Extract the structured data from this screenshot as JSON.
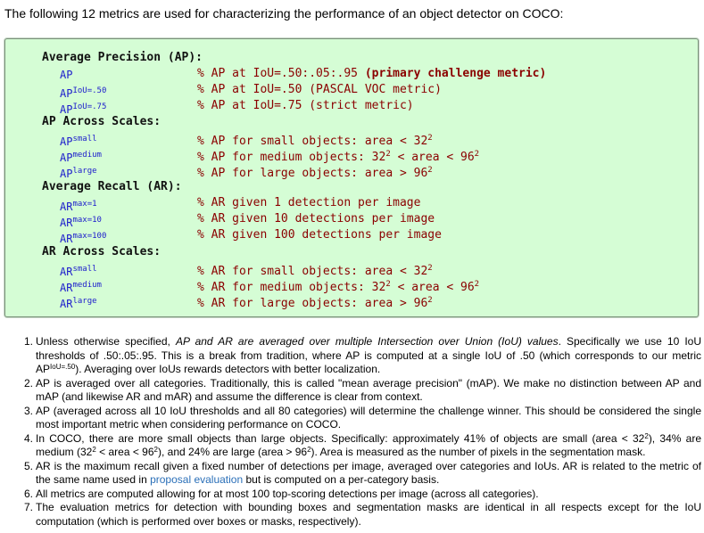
{
  "intro": "The following 12 metrics are used for characterizing the performance of an object detector on COCO:",
  "metrics_box": {
    "rows": [
      {
        "kind": "head",
        "text": "Average Precision (AP):"
      },
      {
        "kind": "item",
        "name": "AP",
        "sup": "",
        "desc": "% AP at IoU=.50:.05:.95",
        "bold": " (primary challenge metric)"
      },
      {
        "kind": "item",
        "name": "AP",
        "sup": "IoU=.50",
        "desc": "% AP at IoU=.50 (PASCAL VOC metric)"
      },
      {
        "kind": "item",
        "name": "AP",
        "sup": "IoU=.75",
        "desc": "% AP at IoU=.75 (strict metric)"
      },
      {
        "kind": "head",
        "text": "AP Across Scales:"
      },
      {
        "kind": "item",
        "name": "AP",
        "sup": "small",
        "desc": "% AP for small objects: area < 32",
        "desc_sup": "2"
      },
      {
        "kind": "item",
        "name": "AP",
        "sup": "medium",
        "desc": "% AP for medium objects: 32",
        "desc_sup": "2",
        "desc_tail": " < area < 96",
        "desc_tail_sup": "2"
      },
      {
        "kind": "item",
        "name": "AP",
        "sup": "large",
        "desc": "% AP for large objects: area > 96",
        "desc_sup": "2"
      },
      {
        "kind": "head",
        "text": "Average Recall (AR):"
      },
      {
        "kind": "item",
        "name": "AR",
        "sup": "max=1",
        "desc": "% AR given 1 detection per image"
      },
      {
        "kind": "item",
        "name": "AR",
        "sup": "max=10",
        "desc": "% AR given 10 detections per image"
      },
      {
        "kind": "item",
        "name": "AR",
        "sup": "max=100",
        "desc": "% AR given 100 detections per image"
      },
      {
        "kind": "head",
        "text": "AR Across Scales:"
      },
      {
        "kind": "item",
        "name": "AR",
        "sup": "small",
        "desc": "% AR for small objects: area < 32",
        "desc_sup": "2"
      },
      {
        "kind": "item",
        "name": "AR",
        "sup": "medium",
        "desc": "% AR for medium objects: 32",
        "desc_sup": "2",
        "desc_tail": " < area < 96",
        "desc_tail_sup": "2"
      },
      {
        "kind": "item",
        "name": "AR",
        "sup": "large",
        "desc": "% AR for large objects: area > 96",
        "desc_sup": "2"
      }
    ]
  },
  "notes": [
    {
      "num": "1.",
      "parts": [
        {
          "t": "Unless otherwise specified, "
        },
        {
          "t": "AP and AR are averaged over multiple Intersection over Union (IoU) values",
          "i": true
        },
        {
          "t": ". Specifically we use 10 IoU thresholds of .50:.05:.95. This is a break from tradition, where AP is computed at a single IoU of .50 (which corresponds to our metric AP"
        },
        {
          "t": "IoU=.50",
          "sup": true
        },
        {
          "t": "). Averaging over IoUs rewards detectors with better localization."
        }
      ]
    },
    {
      "num": "2.",
      "parts": [
        {
          "t": "AP is averaged over all categories. Traditionally, this is called \"mean average precision\" (mAP). We make no distinction between AP and mAP (and likewise AR and mAR) and assume the difference is clear from context."
        }
      ]
    },
    {
      "num": "3.",
      "parts": [
        {
          "t": "AP (averaged across all 10 IoU thresholds and all 80 categories) will determine the challenge winner. This should be considered the single most important metric when considering performance on COCO."
        }
      ]
    },
    {
      "num": "4.",
      "parts": [
        {
          "t": "In COCO, there are more small objects than large objects. Specifically: approximately 41% of objects are small (area < 32"
        },
        {
          "t": "2",
          "sup": true
        },
        {
          "t": "), 34% are medium (32"
        },
        {
          "t": "2",
          "sup": true
        },
        {
          "t": " < area < 96"
        },
        {
          "t": "2",
          "sup": true
        },
        {
          "t": "), and 24% are large (area > 96"
        },
        {
          "t": "2",
          "sup": true
        },
        {
          "t": "). Area is measured as the number of pixels in the segmentation mask."
        }
      ]
    },
    {
      "num": "5.",
      "parts": [
        {
          "t": "AR is the maximum recall given a fixed number of detections per image, averaged over categories and IoUs. AR is related to the metric of the same name used in "
        },
        {
          "t": "proposal evaluation",
          "link": true
        },
        {
          "t": " but is computed on a per-category basis."
        }
      ]
    },
    {
      "num": "6.",
      "parts": [
        {
          "t": "All metrics are computed allowing for at most 100 top-scoring detections per image (across all categories)."
        }
      ]
    },
    {
      "num": "7.",
      "parts": [
        {
          "t": "The evaluation metrics for detection with bounding boxes and segmentation masks are identical in all respects except for the IoU computation (which is performed over boxes or masks, respectively)."
        }
      ]
    }
  ],
  "colors": {
    "box_bg": "#d5fdd5",
    "metric_name": "#1c1ccc",
    "metric_desc": "#8b0000",
    "link": "#2a6fb8"
  }
}
